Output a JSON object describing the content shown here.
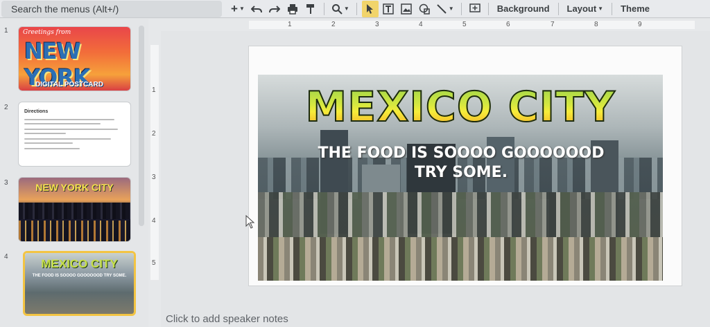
{
  "toolbar": {
    "menu_search": "Search the menus (Alt+/)",
    "background_label": "Background",
    "layout_label": "Layout",
    "theme_label": "Theme"
  },
  "ruler": {
    "horizontal_ticks": [
      "1",
      "2",
      "3",
      "4",
      "5",
      "6",
      "7",
      "8",
      "9"
    ],
    "vertical_ticks": [
      "1",
      "2",
      "3",
      "4",
      "5"
    ]
  },
  "filmstrip": {
    "slides": [
      {
        "number": "1",
        "greeting": "Greetings from",
        "big_text": "NEW YORK",
        "footer": "DIGITAL POSTCARD"
      },
      {
        "number": "2",
        "title": "Directions"
      },
      {
        "number": "3",
        "title": "NEW YORK CITY"
      },
      {
        "number": "4",
        "title": "MEXICO CITY",
        "subtitle": "THE FOOD IS SOOOO GOOOOOOD TRY SOME."
      }
    ]
  },
  "slide": {
    "title": "MEXICO CITY",
    "subtitle": "THE FOOD IS SOOOO GOOOOOOD TRY SOME."
  },
  "notes": {
    "placeholder": "Click to add speaker notes"
  },
  "colors": {
    "selected_thumb_border": "#f3c443",
    "active_tool": "#f1d46b",
    "title_green": "#9ad34a",
    "title_yellow": "#f7ec3a"
  }
}
